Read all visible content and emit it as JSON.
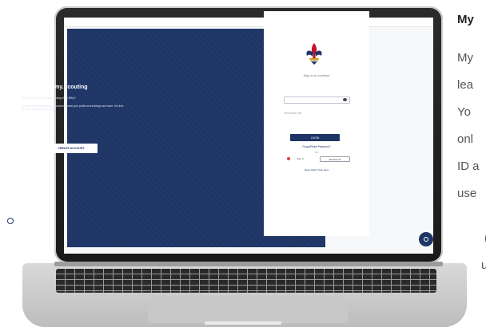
{
  "screen": {
    "welcome_title": "Welcome to my.Scouting",
    "tagline": "Want to join/renew? Not finding it on BSA?",
    "paragraph": "Create a BSA my.Scouting account to access your profile and trainings and more. It is free, fast, and easy to set up today.",
    "learn_more": "Learn more here",
    "create_button": "CREATE ACCOUNT",
    "sign_in_title": "Sign in to continue",
    "password_hint": "Remember Me",
    "login_button": "LOGIN",
    "forgot_link": "Forgot/Reset Password?",
    "or_divider": "OR",
    "google_label": "Sign In",
    "alt_button": "Member ID",
    "help_link": "Need Help? Click Here",
    "colors": {
      "navy": "#1f3566",
      "scout_red": "#c8102e",
      "accent": "#ffffff"
    }
  },
  "article": {
    "heading": "My",
    "lines": [
      "My",
      "lea",
      "Yo",
      "onl",
      "ID a",
      "use",
      "(",
      "u"
    ]
  },
  "icons": [
    "bsa-fleur-de-lis-icon",
    "eye-icon",
    "google-icon",
    "chat-icon",
    "scout-badge-icon"
  ]
}
